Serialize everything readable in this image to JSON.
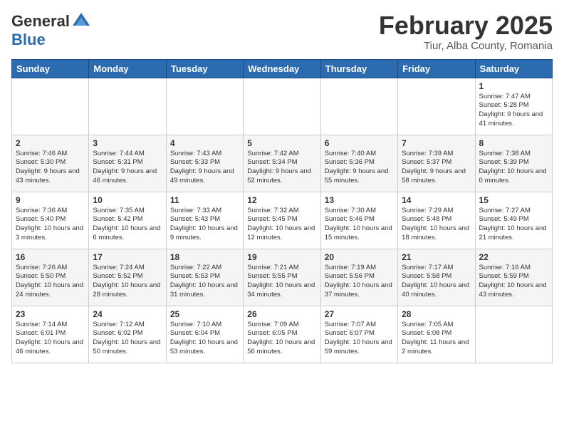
{
  "header": {
    "logo_line1": "General",
    "logo_line2": "Blue",
    "title": "February 2025",
    "subtitle": "Tiur, Alba County, Romania"
  },
  "weekdays": [
    "Sunday",
    "Monday",
    "Tuesday",
    "Wednesday",
    "Thursday",
    "Friday",
    "Saturday"
  ],
  "weeks": [
    [
      {
        "day": "",
        "info": ""
      },
      {
        "day": "",
        "info": ""
      },
      {
        "day": "",
        "info": ""
      },
      {
        "day": "",
        "info": ""
      },
      {
        "day": "",
        "info": ""
      },
      {
        "day": "",
        "info": ""
      },
      {
        "day": "1",
        "info": "Sunrise: 7:47 AM\nSunset: 5:28 PM\nDaylight: 9 hours\nand 41 minutes."
      }
    ],
    [
      {
        "day": "2",
        "info": "Sunrise: 7:46 AM\nSunset: 5:30 PM\nDaylight: 9 hours\nand 43 minutes."
      },
      {
        "day": "3",
        "info": "Sunrise: 7:44 AM\nSunset: 5:31 PM\nDaylight: 9 hours\nand 46 minutes."
      },
      {
        "day": "4",
        "info": "Sunrise: 7:43 AM\nSunset: 5:33 PM\nDaylight: 9 hours\nand 49 minutes."
      },
      {
        "day": "5",
        "info": "Sunrise: 7:42 AM\nSunset: 5:34 PM\nDaylight: 9 hours\nand 52 minutes."
      },
      {
        "day": "6",
        "info": "Sunrise: 7:40 AM\nSunset: 5:36 PM\nDaylight: 9 hours\nand 55 minutes."
      },
      {
        "day": "7",
        "info": "Sunrise: 7:39 AM\nSunset: 5:37 PM\nDaylight: 9 hours\nand 58 minutes."
      },
      {
        "day": "8",
        "info": "Sunrise: 7:38 AM\nSunset: 5:39 PM\nDaylight: 10 hours\nand 0 minutes."
      }
    ],
    [
      {
        "day": "9",
        "info": "Sunrise: 7:36 AM\nSunset: 5:40 PM\nDaylight: 10 hours\nand 3 minutes."
      },
      {
        "day": "10",
        "info": "Sunrise: 7:35 AM\nSunset: 5:42 PM\nDaylight: 10 hours\nand 6 minutes."
      },
      {
        "day": "11",
        "info": "Sunrise: 7:33 AM\nSunset: 5:43 PM\nDaylight: 10 hours\nand 9 minutes."
      },
      {
        "day": "12",
        "info": "Sunrise: 7:32 AM\nSunset: 5:45 PM\nDaylight: 10 hours\nand 12 minutes."
      },
      {
        "day": "13",
        "info": "Sunrise: 7:30 AM\nSunset: 5:46 PM\nDaylight: 10 hours\nand 15 minutes."
      },
      {
        "day": "14",
        "info": "Sunrise: 7:29 AM\nSunset: 5:48 PM\nDaylight: 10 hours\nand 18 minutes."
      },
      {
        "day": "15",
        "info": "Sunrise: 7:27 AM\nSunset: 5:49 PM\nDaylight: 10 hours\nand 21 minutes."
      }
    ],
    [
      {
        "day": "16",
        "info": "Sunrise: 7:26 AM\nSunset: 5:50 PM\nDaylight: 10 hours\nand 24 minutes."
      },
      {
        "day": "17",
        "info": "Sunrise: 7:24 AM\nSunset: 5:52 PM\nDaylight: 10 hours\nand 28 minutes."
      },
      {
        "day": "18",
        "info": "Sunrise: 7:22 AM\nSunset: 5:53 PM\nDaylight: 10 hours\nand 31 minutes."
      },
      {
        "day": "19",
        "info": "Sunrise: 7:21 AM\nSunset: 5:55 PM\nDaylight: 10 hours\nand 34 minutes."
      },
      {
        "day": "20",
        "info": "Sunrise: 7:19 AM\nSunset: 5:56 PM\nDaylight: 10 hours\nand 37 minutes."
      },
      {
        "day": "21",
        "info": "Sunrise: 7:17 AM\nSunset: 5:58 PM\nDaylight: 10 hours\nand 40 minutes."
      },
      {
        "day": "22",
        "info": "Sunrise: 7:16 AM\nSunset: 5:59 PM\nDaylight: 10 hours\nand 43 minutes."
      }
    ],
    [
      {
        "day": "23",
        "info": "Sunrise: 7:14 AM\nSunset: 6:01 PM\nDaylight: 10 hours\nand 46 minutes."
      },
      {
        "day": "24",
        "info": "Sunrise: 7:12 AM\nSunset: 6:02 PM\nDaylight: 10 hours\nand 50 minutes."
      },
      {
        "day": "25",
        "info": "Sunrise: 7:10 AM\nSunset: 6:04 PM\nDaylight: 10 hours\nand 53 minutes."
      },
      {
        "day": "26",
        "info": "Sunrise: 7:09 AM\nSunset: 6:05 PM\nDaylight: 10 hours\nand 56 minutes."
      },
      {
        "day": "27",
        "info": "Sunrise: 7:07 AM\nSunset: 6:07 PM\nDaylight: 10 hours\nand 59 minutes."
      },
      {
        "day": "28",
        "info": "Sunrise: 7:05 AM\nSunset: 6:08 PM\nDaylight: 11 hours\nand 2 minutes."
      },
      {
        "day": "",
        "info": ""
      }
    ]
  ]
}
